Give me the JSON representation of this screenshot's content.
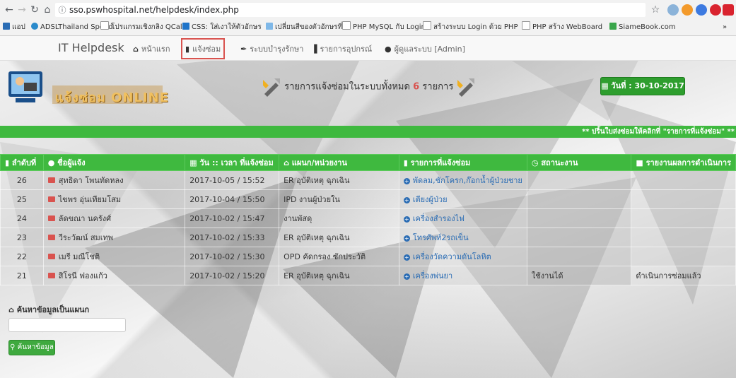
{
  "browser": {
    "url": "sso.pswhospital.net/helpdesk/index.php",
    "bookmarks": [
      "แอป",
      "ADSLThailand Speed",
      "โปรแกรมเชิงกลิง QCall",
      "CSS: ใส่เงาให้ตัวอักษร",
      "เปลี่ยนสีของตัวอักษรที่",
      "PHP MySQL กับ Login",
      "สร้างระบบ Login ด้วย PHP",
      "PHP สร้าง WebBoard",
      "SiameBook.com"
    ],
    "more_bookmarks": "»"
  },
  "nav": {
    "brand": "IT Helpdesk",
    "items": [
      "หน้าแรก",
      "แจ้งซ่อม",
      "ระบบบำรุงรักษา",
      "รายการอุปกรณ์",
      "ผู้ดูแลระบบ [Admin]"
    ]
  },
  "header": {
    "logo_text": "แจ้งซ่อม ONLINE",
    "summary_prefix": "รายการแจ้งซ่อมในระบบทั้งหมด",
    "summary_count": "6",
    "summary_suffix": "รายการ",
    "date_label": "วันที่ : 30-10-2017"
  },
  "marquee": "** ปริ้นใบส่งซ่อมให้คลิกที่ \"รายการที่แจ้งซ่อม\" **",
  "table": {
    "headers": [
      "ลำดับที่",
      "ชื่อผู้แจ้ง",
      "วัน :: เวลา ที่แจ้งซ่อม",
      "แผนก/หน่วยงาน",
      "รายการที่แจ้งซ่อม",
      "สถานะงาน",
      "รายงานผลการดำเนินการ"
    ],
    "rows": [
      {
        "no": "26",
        "name": "สุทธิดา โพนทัดหลง",
        "datetime": "2017-10-05 / 15:52",
        "dept": "ER อุบัติเหตุ ฉุกเฉิน",
        "item": "พัดลม,ชักโครก,ก๊อกน้ำผู้ป่วยชาย",
        "status": "",
        "report": ""
      },
      {
        "no": "25",
        "name": "ไขพร อุ่นเทียมโสม",
        "datetime": "2017-10-04 / 15:50",
        "dept": "IPD งานผู้ป่วยใน",
        "item": "เตียงผู้ป่วย",
        "status": "",
        "report": ""
      },
      {
        "no": "24",
        "name": "ลัดขณา นครังศ์",
        "datetime": "2017-10-02 / 15:47",
        "dept": "งานพัสดุ",
        "item": "เครื่องสำรองไฟ",
        "status": "",
        "report": ""
      },
      {
        "no": "23",
        "name": "วีระวัฒน์ สมเทพ",
        "datetime": "2017-10-02 / 15:33",
        "dept": "ER อุบัติเหตุ ฉุกเฉิน",
        "item": "โทรศัพท์2รถเข็น",
        "status": "",
        "report": ""
      },
      {
        "no": "22",
        "name": "เมรี มณีโชติ",
        "datetime": "2017-10-02 / 15:30",
        "dept": "OPD คัดกรอง ซักประวัติ",
        "item": "เครื่องวัดความดันโลหิต",
        "status": "",
        "report": ""
      },
      {
        "no": "21",
        "name": "สิโรนี ฟองแก้ว",
        "datetime": "2017-10-02 / 15:20",
        "dept": "ER อุบัติเหตุ ฉุกเฉิน",
        "item": "เครื่องพ่นยา",
        "status": "ใช้งานได้",
        "report": "ดำเนินการซ่อมแล้ว"
      }
    ]
  },
  "search": {
    "label": "ค้นหาข้อมูลเป็นแผนก",
    "placeholder": "",
    "button": "ค้นหาข้อมูล"
  },
  "colors": {
    "accent_green": "#3fb93f",
    "alert_red": "#d9534f",
    "link_blue": "#2a6cb4"
  },
  "icons": [
    "back-icon",
    "forward-icon",
    "reload-icon",
    "home-icon",
    "info-icon",
    "star-icon",
    "wrench-icon",
    "calendar-icon",
    "flag-icon",
    "plus-circle-icon",
    "user-icon",
    "search-icon"
  ]
}
